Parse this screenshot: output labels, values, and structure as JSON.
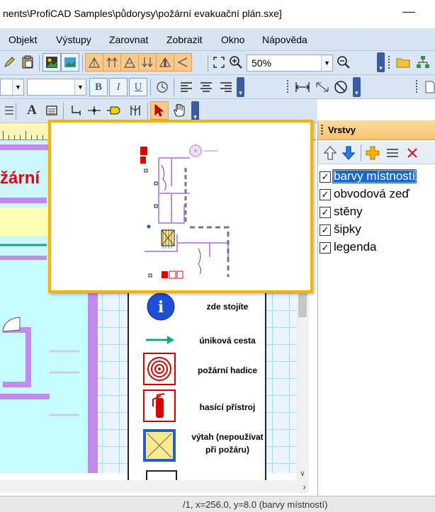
{
  "window": {
    "title": "nents\\ProfiCAD Samples\\půdorysy\\požární evakuační plán.sxe]",
    "minimize_glyph": "—"
  },
  "menu": [
    "Objekt",
    "Výstupy",
    "Zarovnat",
    "Zobrazit",
    "Okno",
    "Nápověda"
  ],
  "toolbar": {
    "zoom_value": "50%",
    "font_size_value": "",
    "bold_label": "B",
    "italic_label": "I",
    "underline_label": "U",
    "text_tool_label": "A",
    "icons": [
      "pencil-icon",
      "paste-icon",
      "image-icon",
      "picture-icon",
      "align-icon",
      "fit-screen-icon",
      "zoom-in-icon",
      "zoom-out-icon",
      "folder-icon",
      "network-icon",
      "align-left-icon",
      "align-center-icon",
      "align-right-icon",
      "dimension-icon",
      "arrow-icon",
      "circle-icon",
      "select-arrow-icon",
      "hand-icon"
    ]
  },
  "drawing": {
    "title_fragment": "žární",
    "legend": [
      {
        "label": "zde stojíte",
        "icon": "info-icon"
      },
      {
        "label": "úniková cesta",
        "icon": "escape-arrow-icon"
      },
      {
        "label": "požární hadice",
        "icon": "fire-hose-icon"
      },
      {
        "label": "hasící přístroj",
        "icon": "fire-extinguisher-icon"
      },
      {
        "label_line1": "výtah (nepoužívat",
        "label_line2": "při požáru)",
        "icon": "elevator-icon"
      }
    ],
    "colors": {
      "title_red": "#e8000a",
      "wall_purple": "#c38bef",
      "arrow_green": "#1aa87a",
      "info_blue": "#1f4fd8",
      "grid": "#a8d8f0",
      "navigator_border": "#f5b400"
    }
  },
  "layers_panel": {
    "title": "Vrstvy",
    "layers": [
      {
        "name": "barvy místností",
        "checked": true,
        "selected": true
      },
      {
        "name": "obvodová zeď",
        "checked": true,
        "selected": false
      },
      {
        "name": "stěny",
        "checked": true,
        "selected": false
      },
      {
        "name": "šipky",
        "checked": true,
        "selected": false
      },
      {
        "name": "legenda",
        "checked": true,
        "selected": false
      }
    ]
  },
  "status_bar": {
    "text": "/1, x=256.0, y=8.0 (barvy místností)"
  }
}
